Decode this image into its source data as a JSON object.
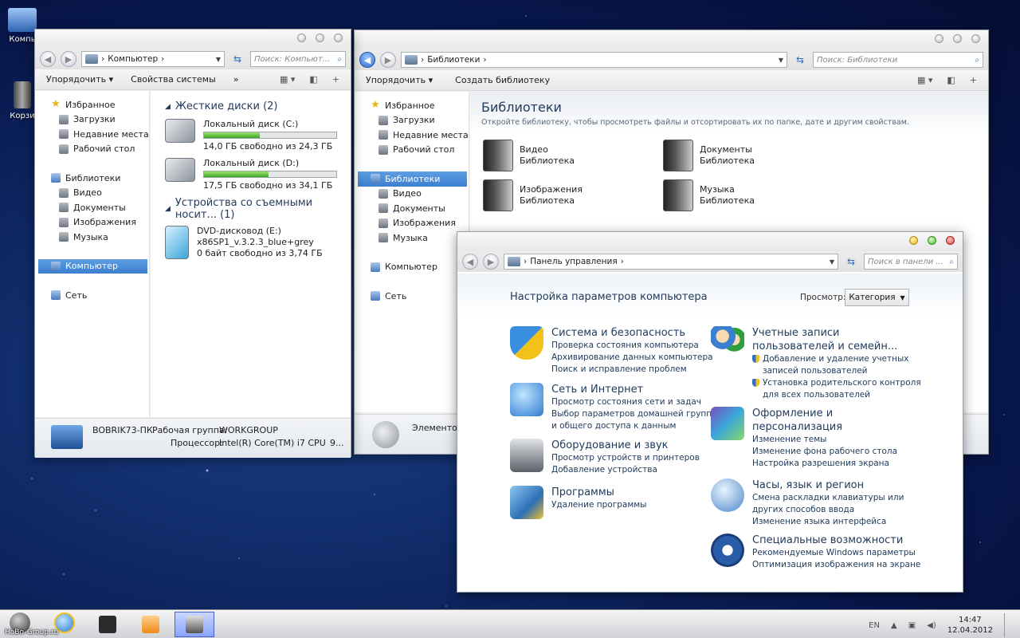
{
  "desktop": {
    "icons": [
      {
        "label": "Компь"
      },
      {
        "label": "Корзи"
      }
    ]
  },
  "computer_window": {
    "address": "Компьютер",
    "search_placeholder": "Поиск: Компьют...",
    "toolbar": {
      "organize": "Упорядочить",
      "system_props": "Свойства системы",
      "more": "»"
    },
    "nav": {
      "favorites": "Избранное",
      "fav_items": [
        "Загрузки",
        "Недавние места",
        "Рабочий стол"
      ],
      "libraries": "Библиотеки",
      "lib_items": [
        "Видео",
        "Документы",
        "Изображения",
        "Музыка"
      ],
      "computer": "Компьютер",
      "network": "Сеть"
    },
    "hdd_group": "Жесткие диски (2)",
    "drives": [
      {
        "name": "Локальный диск (C:)",
        "free": "14,0 ГБ свободно из 24,3 ГБ",
        "used_fraction": 0.42
      },
      {
        "name": "Локальный диск (D:)",
        "free": "17,5 ГБ свободно из 34,1 ГБ",
        "used_fraction": 0.49
      }
    ],
    "removable_group": "Устройства со съемными носит... (1)",
    "dvd": {
      "name": "DVD-дисковод (E:)",
      "label": "x86SP1_v.3.2.3_blue+grey",
      "free": "0 байт свободно из 3,74 ГБ"
    },
    "details": {
      "pc_name": "BOBRIK73-ПК",
      "workgroup_label": "Рабочая группа:",
      "workgroup": "WORKGROUP",
      "cpu_label": "Процессор:",
      "cpu": "Intel(R) Core(TM) i7 CPU",
      "cpu_more": "9..."
    }
  },
  "libraries_window": {
    "address": "Библиотеки",
    "search_placeholder": "Поиск: Библиотеки",
    "toolbar": {
      "organize": "Упорядочить",
      "create_library": "Создать библиотеку"
    },
    "nav": {
      "favorites": "Избранное",
      "fav_items": [
        "Загрузки",
        "Недавние места",
        "Рабочий стол"
      ],
      "libraries": "Библиотеки",
      "lib_items": [
        "Видео",
        "Документы",
        "Изображения",
        "Музыка"
      ],
      "computer": "Компьютер",
      "network": "Сеть"
    },
    "title": "Библиотеки",
    "subtitle": "Откройте библиотеку, чтобы просмотреть файлы и отсортировать их по папке, дате и другим свойствам.",
    "items": [
      {
        "name": "Видео",
        "kind": "Библиотека"
      },
      {
        "name": "Документы",
        "kind": "Библиотека"
      },
      {
        "name": "Изображения",
        "kind": "Библиотека"
      },
      {
        "name": "Музыка",
        "kind": "Библиотека"
      }
    ],
    "details_text": "Элементов"
  },
  "control_panel": {
    "address": "Панель управления",
    "search_placeholder": "Поиск в панели ...",
    "heading": "Настройка параметров компьютера",
    "view_label": "Просмотр:",
    "view_value": "Категория",
    "left": [
      {
        "title": "Система и безопасность",
        "links": [
          "Проверка состояния компьютера",
          "Архивирование данных компьютера",
          "Поиск и исправление проблем"
        ]
      },
      {
        "title": "Сеть и Интернет",
        "links": [
          "Просмотр состояния сети и задач",
          "Выбор параметров домашней группы",
          "и общего доступа к данным"
        ]
      },
      {
        "title": "Оборудование и звук",
        "links": [
          "Просмотр устройств и принтеров",
          "Добавление устройства"
        ]
      },
      {
        "title": "Программы",
        "links": [
          "Удаление программы"
        ]
      }
    ],
    "right": [
      {
        "title1": "Учетные записи",
        "title2": "пользователей и семейн...",
        "links": [
          "Добавление и удаление учетных",
          "записей пользователей",
          "Установка родительского контроля",
          "для всех пользователей"
        ]
      },
      {
        "title1": "Оформление и",
        "title2": "персонализация",
        "links": [
          "Изменение темы",
          "Изменение фона рабочего стола",
          "Настройка разрешения экрана"
        ]
      },
      {
        "title1": "Часы, язык и регион",
        "links": [
          "Смена раскладки клавиатуры или",
          "других способов ввода",
          "Изменение языка интерфейса"
        ]
      },
      {
        "title1": "Специальные возможности",
        "links": [
          "Рекомендуемые Windows параметры",
          "Оптимизация изображения на экране"
        ]
      }
    ]
  },
  "taskbar": {
    "start_label": "HoBo-Group.ru",
    "lang": "EN",
    "time": "14:47",
    "date": "12.04.2012"
  },
  "colors": {
    "accent": "#3b7fd0",
    "link": "#1e395b",
    "progress": "#3aa528"
  }
}
